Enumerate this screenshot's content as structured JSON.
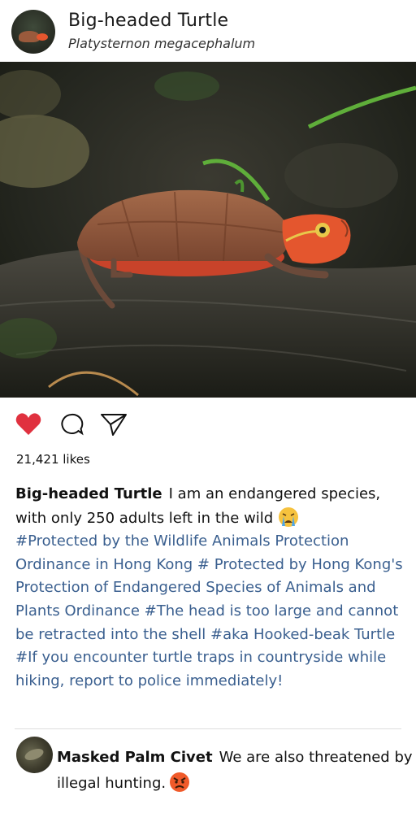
{
  "header": {
    "title": "Big-headed Turtle",
    "subtitle": "Platysternon megacephalum"
  },
  "photo": {
    "description_icon": "turtle-photo"
  },
  "actions": {
    "like_icon": "heart-icon",
    "comment_icon": "comment-bubble-icon",
    "share_icon": "send-icon",
    "liked": true,
    "like_color": "#e0313f"
  },
  "likes": {
    "count_text": "21,421 likes"
  },
  "caption": {
    "username": "Big-headed Turtle",
    "text": "I am an endangered species, with only 250 adults left in the wild",
    "emoji": "crying-face",
    "hashtags": "#Protected by the Wildlife Animals Protection Ordinance in Hong Kong # Protected by Hong Kong's Protection of Endangered Species of Animals and Plants Ordinance #The head is too large and cannot be retracted into the shell #aka Hooked-beak Turtle #If you encounter turtle traps in countryside while hiking, report to police immediately!",
    "hashtag_color": "#3a5f8f"
  },
  "comment": {
    "username": "Masked Palm Civet",
    "text": "We are also threatened by illegal hunting.",
    "emoji": "angry-face"
  }
}
